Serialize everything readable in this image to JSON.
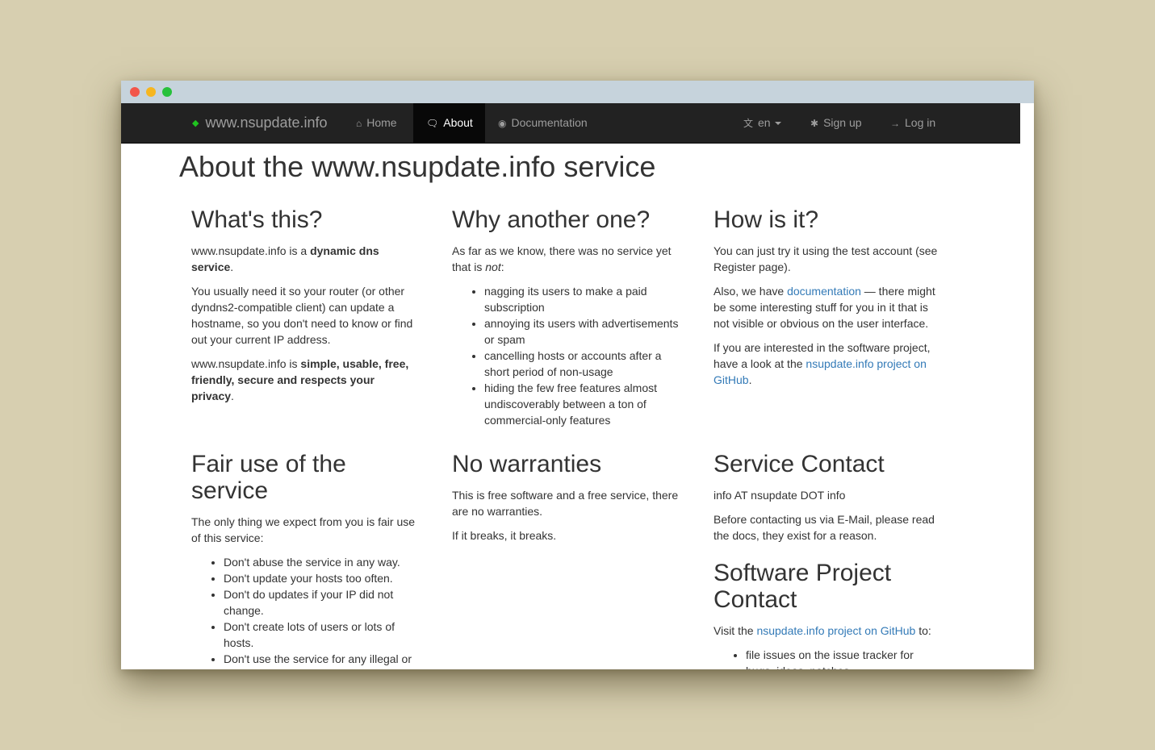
{
  "navbar": {
    "brand": "www.nsupdate.info",
    "home": "Home",
    "about": "About",
    "documentation": "Documentation",
    "language": "en",
    "signup": "Sign up",
    "login": "Log in"
  },
  "page": {
    "title": "About the www.nsupdate.info service"
  },
  "whats_this": {
    "heading": "What's this?",
    "p1_pre": "www.nsupdate.info is a ",
    "p1_bold": "dynamic dns service",
    "p1_post": ".",
    "p2": "You usually need it so your router (or other dyndns2-compatible client) can update a hostname, so you don't need to know or find out your current IP address.",
    "p3_pre": "www.nsupdate.info is ",
    "p3_bold": "simple, usable, free, friendly, secure and respects your privacy",
    "p3_post": "."
  },
  "why_another": {
    "heading": "Why another one?",
    "intro_pre": "As far as we know, there was no service yet that is ",
    "intro_em": "not",
    "intro_post": ":",
    "items": [
      "nagging its users to make a paid subscription",
      "annoying its users with advertisements or spam",
      "cancelling hosts or accounts after a short period of non-usage",
      "hiding the few free features almost undiscoverably between a ton of commercial-only features"
    ]
  },
  "how_is_it": {
    "heading": "How is it?",
    "p1": "You can just try it using the test account (see Register page).",
    "p2_pre": "Also, we have ",
    "p2_link": "documentation",
    "p2_post": " — there might be some interesting stuff for you in it that is not visible or obvious on the user interface.",
    "p3_pre": "If you are interested in the software project, have a look at the ",
    "p3_link": "nsupdate.info project on GitHub",
    "p3_post": "."
  },
  "fair_use": {
    "heading": "Fair use of the service",
    "intro": "The only thing we expect from you is fair use of this service:",
    "items": [
      "Don't abuse the service in any way.",
      "Don't update your hosts too often.",
      "Don't do updates if your IP did not change.",
      "Don't create lots of users or lots of hosts.",
      "Don't use the service for any illegal or"
    ]
  },
  "no_warranties": {
    "heading": "No warranties",
    "p1": "This is free software and a free service, there are no warranties.",
    "p2": "If it breaks, it breaks."
  },
  "service_contact": {
    "heading": "Service Contact",
    "p1": "info AT nsupdate DOT info",
    "p2": "Before contacting us via E-Mail, please read the docs, they exist for a reason."
  },
  "software_contact": {
    "heading": "Software Project Contact",
    "intro_pre": "Visit the ",
    "intro_link": "nsupdate.info project on GitHub",
    "intro_post": " to:",
    "items": [
      "file issues on the issue tracker for bugs, ideas, patches"
    ]
  }
}
